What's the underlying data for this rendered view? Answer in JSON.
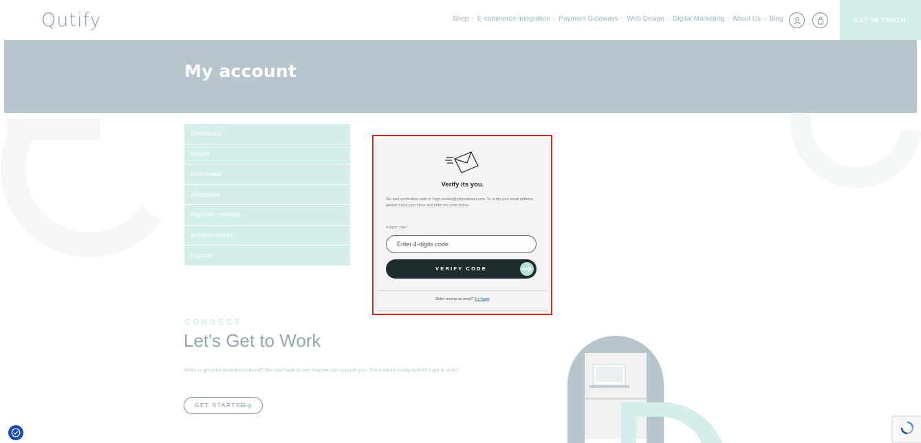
{
  "header": {
    "logo": "Qutify",
    "nav": [
      {
        "label": "Shop",
        "has_dropdown": true
      },
      {
        "label": "E-commerce integration",
        "has_dropdown": true
      },
      {
        "label": "Payment Gateways",
        "has_dropdown": true
      },
      {
        "label": "Web Design",
        "has_dropdown": true
      },
      {
        "label": "Digital Marketing",
        "has_dropdown": true
      },
      {
        "label": "About Us",
        "has_dropdown": true
      },
      {
        "label": "Blog",
        "has_dropdown": false
      }
    ],
    "icons": [
      "user-icon",
      "shopping-bag-icon"
    ],
    "cta": "GET IN TOUCH"
  },
  "banner": {
    "title": "My account"
  },
  "account_nav": {
    "items": [
      "Dashboard",
      "Orders",
      "Downloads",
      "Addresses",
      "Payment methods",
      "Account details",
      "Log out"
    ]
  },
  "verify": {
    "icon": "envelope-icon",
    "title": "Verify its you.",
    "description": "We sent verification code to hugo.santos@tylbynatwest.com. To verify your email address, please check your inbox and enter the code below.",
    "code_label": "4-digits code *",
    "code_placeholder": "Enter 4-digits code",
    "button": "VERIFY CODE",
    "resend_text": "Didn't receive an email?",
    "resend_link": "Try Again"
  },
  "connect": {
    "eyebrow": "CONNECT",
    "heading": "Let's Get to Work",
    "body": "Want to get your business noticed? We can't wait to see how we can support you. Get in touch today and let's get to work!",
    "button": "GET STARTED"
  },
  "colors": {
    "banner": "#b7c6cd",
    "mint": "#d4eeec",
    "dark_button": "#1f2c2e",
    "highlight_border": "#e51e1e",
    "accessibility": "#1c48b3"
  }
}
